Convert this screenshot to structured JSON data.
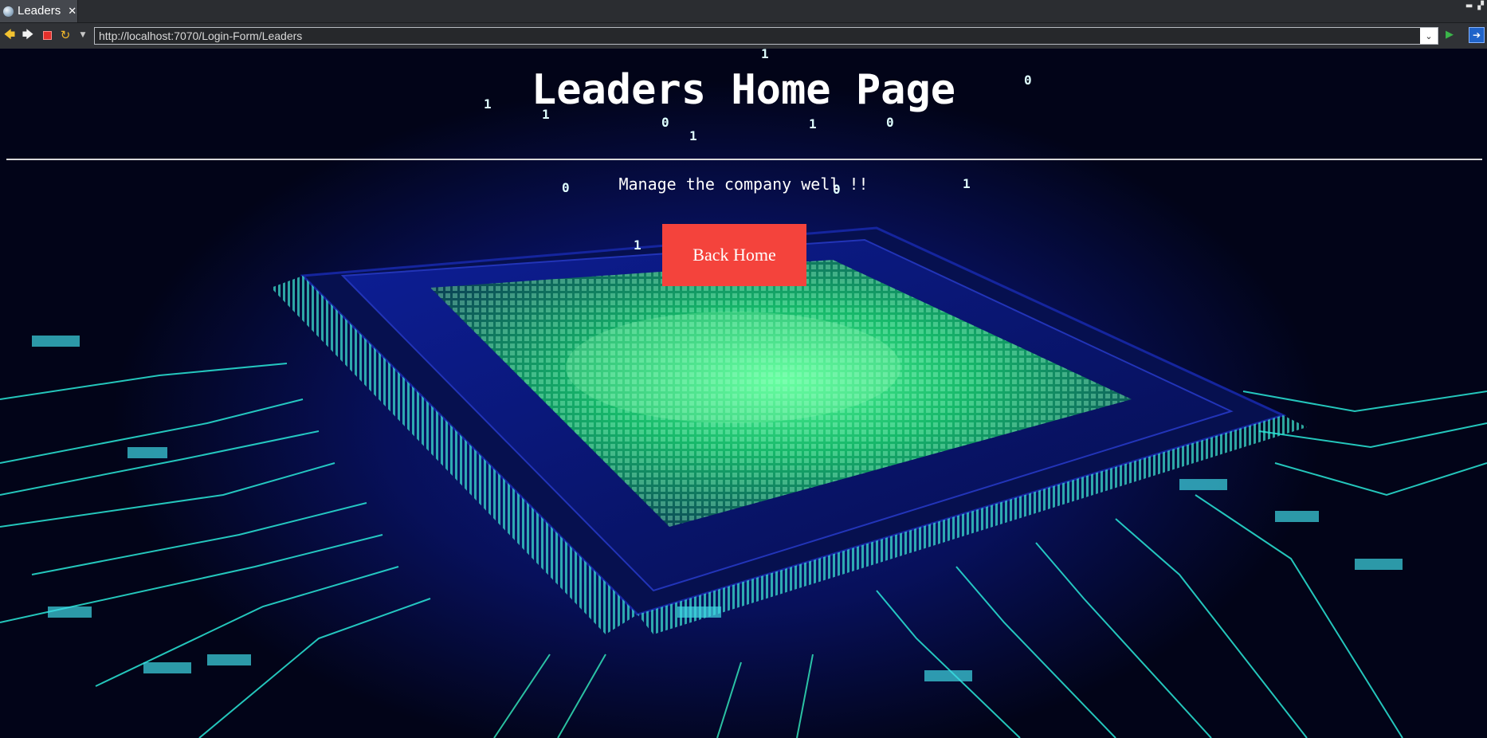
{
  "tab": {
    "title": "Leaders",
    "close_glyph": "✕",
    "icon": "globe-icon"
  },
  "window_controls": {
    "minimize": "▬",
    "restore": "▞"
  },
  "toolbar": {
    "back_icon": "back-arrow-icon",
    "forward_icon": "forward-arrow-icon",
    "stop_icon": "stop-icon",
    "refresh_icon": "refresh-icon",
    "url": "http://localhost:7070/Login-Form/Leaders",
    "go_icon": "go-icon",
    "extension_icon": "extension-icon"
  },
  "page": {
    "title": "Leaders Home Page",
    "subtitle": "Manage the company well !!",
    "back_home_label": "Back Home",
    "binary_digits": [
      "1",
      "0",
      "1",
      "1",
      "0",
      "1",
      "1",
      "0",
      "0",
      "1",
      "0",
      "1"
    ]
  },
  "colors": {
    "button_bg": "#f4433c",
    "text": "#ffffff",
    "circuit_glow": "#34ffa0",
    "circuit_cyan": "#2ae8d8",
    "chip_blue": "#0b1a86"
  }
}
